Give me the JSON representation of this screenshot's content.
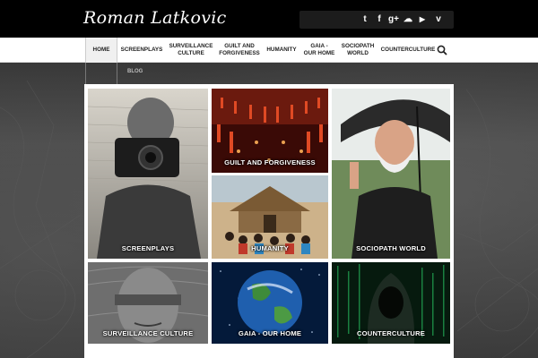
{
  "site": {
    "title": "Roman Latkovic"
  },
  "social_icons": [
    "twitter-icon",
    "facebook-icon",
    "google-plus-icon",
    "soundcloud-icon",
    "youtube-icon",
    "vimeo-icon"
  ],
  "social_glyphs": [
    "t",
    "f",
    "g+",
    "☁",
    "▶",
    "v"
  ],
  "nav": {
    "items": [
      {
        "line1": "HOME",
        "line2": ""
      },
      {
        "line1": "SCREENPLAYS",
        "line2": ""
      },
      {
        "line1": "SURVEILLANCE",
        "line2": "CULTURE"
      },
      {
        "line1": "GUILT AND",
        "line2": "FORGIVENESS"
      },
      {
        "line1": "HUMANITY",
        "line2": ""
      },
      {
        "line1": "GAIA -",
        "line2": "OUR HOME"
      },
      {
        "line1": "SOCIOPATH",
        "line2": "WORLD"
      },
      {
        "line1": "COUNTERCULTURE",
        "line2": ""
      }
    ],
    "sub_item": "BLOG"
  },
  "tiles": {
    "screenplays": "SCREENPLAYS",
    "guilt": "GUILT AND FORGIVENESS",
    "humanity": "HUMANITY",
    "sociopath": "SOCIOPATH WORLD",
    "surveillance": "SURVEILLANCE CULTURE",
    "gaia": "GAIA - OUR HOME",
    "counterculture": "COUNTERCULTURE"
  },
  "colors": {
    "header_bg": "#000000",
    "nav_bg": "#ffffff",
    "caption": "#ffffff"
  }
}
